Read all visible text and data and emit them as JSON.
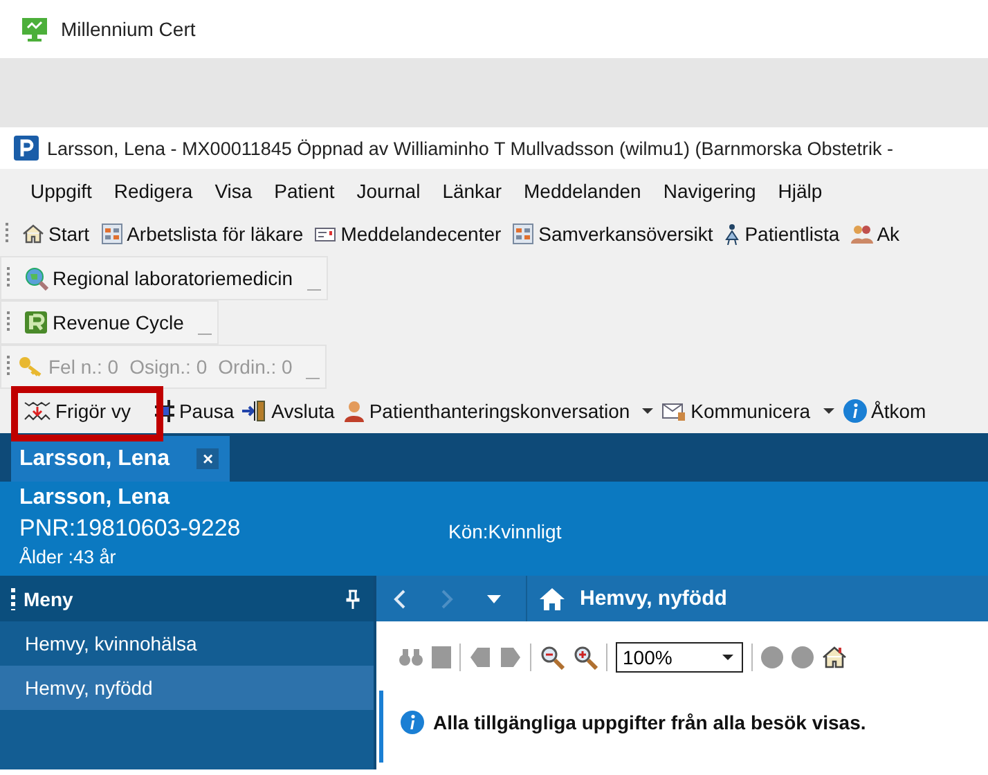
{
  "app": {
    "title": "Millennium Cert"
  },
  "window": {
    "title": "Larsson, Lena - MX00011845 Öppnad av Williaminho T Mullvadsson (wilmu1) (Barnmorska Obstetrik -"
  },
  "menu": [
    "Uppgift",
    "Redigera",
    "Visa",
    "Patient",
    "Journal",
    "Länkar",
    "Meddelanden",
    "Navigering",
    "Hjälp"
  ],
  "toolbars": [
    {
      "items": [
        {
          "label": "Start"
        },
        {
          "label": "Arbetslista för läkare"
        },
        {
          "label": "Meddelandecenter"
        },
        {
          "label": "Samverkansöversikt"
        },
        {
          "label": "Patientlista"
        },
        {
          "label": "Ak"
        }
      ]
    },
    {
      "items": [
        {
          "label": "Regional laboratoriemedicin"
        }
      ]
    },
    {
      "items": [
        {
          "label": "Revenue Cycle"
        }
      ]
    },
    {
      "items": [
        {
          "label": "Fel n.: 0",
          "disabled": true
        },
        {
          "label": "Osign.: 0",
          "disabled": true
        },
        {
          "label": "Ordin.: 0",
          "disabled": true
        }
      ]
    }
  ],
  "actions": [
    {
      "label": "Frigör vy",
      "dropdown": false
    },
    {
      "label": "Pausa",
      "dropdown": false
    },
    {
      "label": "Avsluta",
      "dropdown": false
    },
    {
      "label": "Patienthanteringskonversation",
      "dropdown": true
    },
    {
      "label": "Kommunicera",
      "dropdown": true
    },
    {
      "label": "Åtkom",
      "dropdown": false
    }
  ],
  "tabs": [
    {
      "label": "Larsson, Lena",
      "selected": true,
      "close": "×"
    }
  ],
  "patient": {
    "name": "Larsson, Lena",
    "pnr": "PNR:19810603-9228",
    "age": "Ålder :43 år",
    "gender": "Kön:Kvinnligt"
  },
  "sidebar": {
    "title": "Meny",
    "items": [
      {
        "label": "Hemvy, kvinnohälsa",
        "selected": false
      },
      {
        "label": "Hemvy, nyfödd",
        "selected": true
      }
    ]
  },
  "content": {
    "title": "Hemvy, nyfödd",
    "zoom": "100%",
    "info": "Alla tillgängliga uppgifter från alla besök visas."
  }
}
